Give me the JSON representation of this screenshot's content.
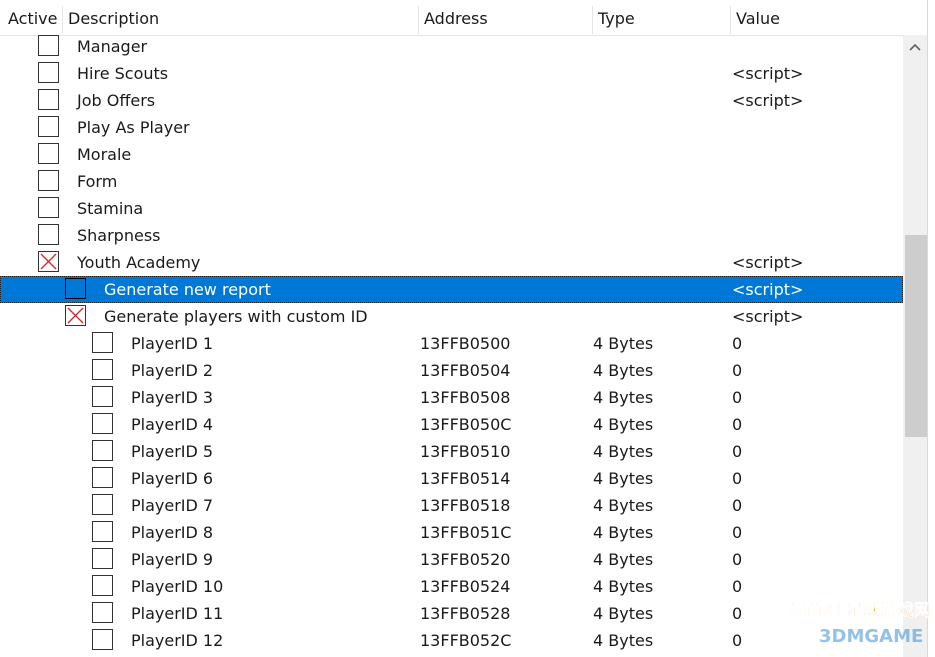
{
  "columns": {
    "active": "Active",
    "description": "Description",
    "address": "Address",
    "type": "Type",
    "value": "Value"
  },
  "rows": [
    {
      "description": "Manager",
      "address": "",
      "type": "",
      "value": "",
      "checked": false,
      "indent": 0,
      "selected": false
    },
    {
      "description": "Hire Scouts",
      "address": "",
      "type": "",
      "value": "<script>",
      "checked": false,
      "indent": 0,
      "selected": false
    },
    {
      "description": "Job Offers",
      "address": "",
      "type": "",
      "value": "<script>",
      "checked": false,
      "indent": 0,
      "selected": false
    },
    {
      "description": "Play As Player",
      "address": "",
      "type": "",
      "value": "",
      "checked": false,
      "indent": 0,
      "selected": false
    },
    {
      "description": "Morale",
      "address": "",
      "type": "",
      "value": "",
      "checked": false,
      "indent": 0,
      "selected": false
    },
    {
      "description": "Form",
      "address": "",
      "type": "",
      "value": "",
      "checked": false,
      "indent": 0,
      "selected": false
    },
    {
      "description": "Stamina",
      "address": "",
      "type": "",
      "value": "",
      "checked": false,
      "indent": 0,
      "selected": false
    },
    {
      "description": "Sharpness",
      "address": "",
      "type": "",
      "value": "",
      "checked": false,
      "indent": 0,
      "selected": false
    },
    {
      "description": "Youth Academy",
      "address": "",
      "type": "",
      "value": "<script>",
      "checked": true,
      "indent": 0,
      "selected": false
    },
    {
      "description": "Generate new report",
      "address": "",
      "type": "",
      "value": "<script>",
      "checked": false,
      "indent": 1,
      "selected": true
    },
    {
      "description": "Generate players with custom ID",
      "address": "",
      "type": "",
      "value": "<script>",
      "checked": true,
      "indent": 1,
      "selected": false
    },
    {
      "description": "PlayerID 1",
      "address": "13FFB0500",
      "type": "4 Bytes",
      "value": "0",
      "checked": false,
      "indent": 2,
      "selected": false
    },
    {
      "description": "PlayerID 2",
      "address": "13FFB0504",
      "type": "4 Bytes",
      "value": "0",
      "checked": false,
      "indent": 2,
      "selected": false
    },
    {
      "description": "PlayerID 3",
      "address": "13FFB0508",
      "type": "4 Bytes",
      "value": "0",
      "checked": false,
      "indent": 2,
      "selected": false
    },
    {
      "description": "PlayerID 4",
      "address": "13FFB050C",
      "type": "4 Bytes",
      "value": "0",
      "checked": false,
      "indent": 2,
      "selected": false
    },
    {
      "description": "PlayerID 5",
      "address": "13FFB0510",
      "type": "4 Bytes",
      "value": "0",
      "checked": false,
      "indent": 2,
      "selected": false
    },
    {
      "description": "PlayerID 6",
      "address": "13FFB0514",
      "type": "4 Bytes",
      "value": "0",
      "checked": false,
      "indent": 2,
      "selected": false
    },
    {
      "description": "PlayerID 7",
      "address": "13FFB0518",
      "type": "4 Bytes",
      "value": "0",
      "checked": false,
      "indent": 2,
      "selected": false
    },
    {
      "description": "PlayerID 8",
      "address": "13FFB051C",
      "type": "4 Bytes",
      "value": "0",
      "checked": false,
      "indent": 2,
      "selected": false
    },
    {
      "description": "PlayerID 9",
      "address": "13FFB0520",
      "type": "4 Bytes",
      "value": "0",
      "checked": false,
      "indent": 2,
      "selected": false
    },
    {
      "description": "PlayerID 10",
      "address": "13FFB0524",
      "type": "4 Bytes",
      "value": "0",
      "checked": false,
      "indent": 2,
      "selected": false
    },
    {
      "description": "PlayerID 11",
      "address": "13FFB0528",
      "type": "4 Bytes",
      "value": "0",
      "checked": false,
      "indent": 2,
      "selected": false
    },
    {
      "description": "PlayerID 12",
      "address": "13FFB052C",
      "type": "4 Bytes",
      "value": "0",
      "checked": false,
      "indent": 2,
      "selected": false
    }
  ],
  "watermark": {
    "top_text": "绿茵吧 足球游戏网",
    "bottom_text": "3DMGAME"
  },
  "colors": {
    "selection": "#0078d7",
    "check_mark": "#d9232d",
    "watermark_orange": "#f39800",
    "watermark_green": "#2e9d3a",
    "watermark_blue": "#3a8fd6"
  },
  "icons": {
    "checked": "red-x-checkbox",
    "scroll_up": "chevron-up-icon"
  }
}
